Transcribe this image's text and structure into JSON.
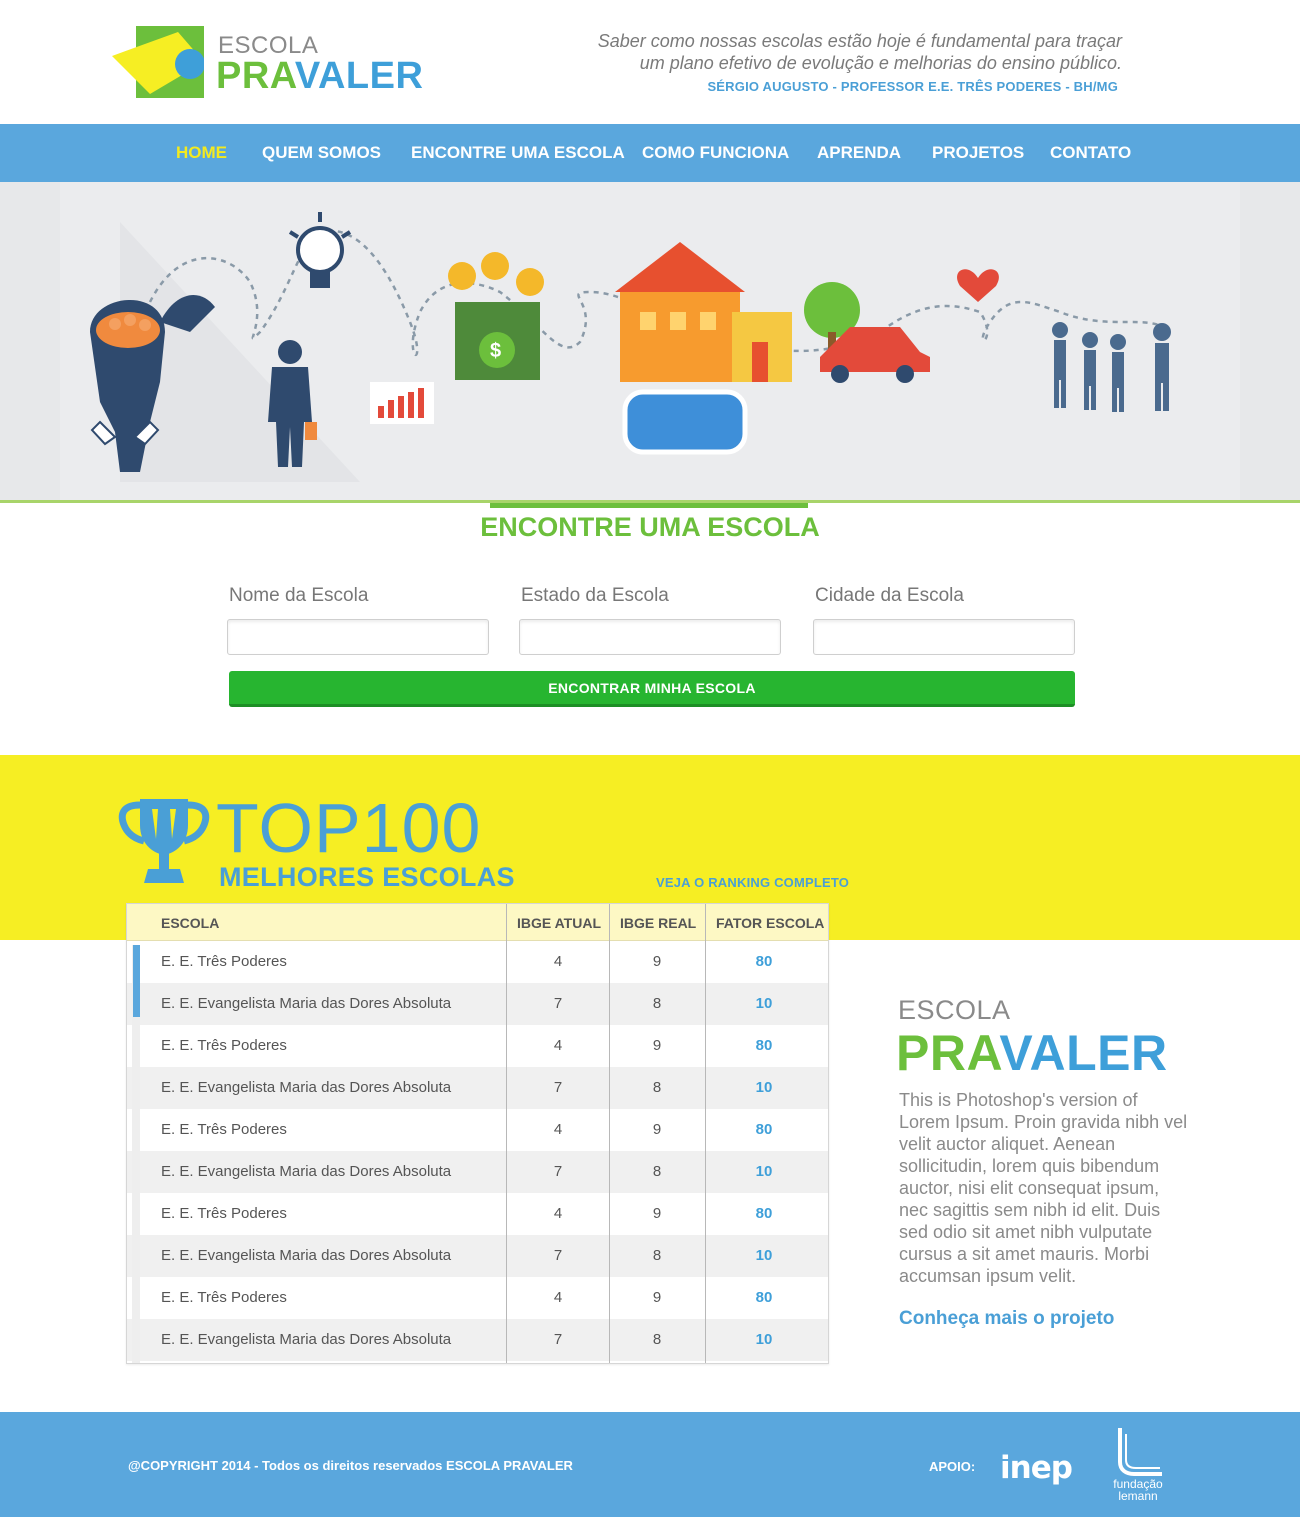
{
  "header": {
    "logo_top": "ESCOLA",
    "logo_pra": "PRA",
    "logo_valer": "VALER",
    "quote_line1": "Saber como nossas escolas estão hoje é fundamental para traçar",
    "quote_line2": "um plano efetivo de evolução e melhorias do ensino público.",
    "quote_author": "SÉRGIO AUGUSTO - PROFESSOR E.E. TRÊS PODERES - BH/MG"
  },
  "nav": {
    "items": [
      "HOME",
      "QUEM SOMOS",
      "ENCONTRE UMA ESCOLA",
      "COMO FUNCIONA",
      "APRENDA",
      "PROJETOS",
      "CONTATO"
    ],
    "active": "HOME",
    "active_color": "#f3ea1f"
  },
  "search": {
    "title": "ENCONTRE UMA ESCOLA",
    "fields": [
      {
        "label": "Nome da Escola",
        "value": ""
      },
      {
        "label": "Estado da Escola",
        "value": ""
      },
      {
        "label": "Cidade da Escola",
        "value": ""
      }
    ],
    "button": "ENCONTRAR MINHA ESCOLA"
  },
  "ranking": {
    "top": "TOP100",
    "subtitle": "MELHORES ESCOLAS",
    "link": "VEJA O RANKING COMPLETO",
    "columns": [
      "ESCOLA",
      "IBGE ATUAL",
      "IBGE REAL",
      "FATOR ESCOLA"
    ],
    "rows": [
      [
        "E. E. Três Poderes",
        "4",
        "9",
        "80"
      ],
      [
        "E. E. Evangelista Maria das Dores Absoluta",
        "7",
        "8",
        "10"
      ],
      [
        "E. E. Três Poderes",
        "4",
        "9",
        "80"
      ],
      [
        "E. E. Evangelista Maria das Dores Absoluta",
        "7",
        "8",
        "10"
      ],
      [
        "E. E. Três Poderes",
        "4",
        "9",
        "80"
      ],
      [
        "E. E. Evangelista Maria das Dores Absoluta",
        "7",
        "8",
        "10"
      ],
      [
        "E. E. Três Poderes",
        "4",
        "9",
        "80"
      ],
      [
        "E. E. Evangelista Maria das Dores Absoluta",
        "7",
        "8",
        "10"
      ],
      [
        "E. E. Três Poderes",
        "4",
        "9",
        "80"
      ],
      [
        "E. E. Evangelista Maria das Dores Absoluta",
        "7",
        "8",
        "10"
      ]
    ]
  },
  "about": {
    "escola": "ESCOLA",
    "pra": "PRA",
    "valer": "VALER",
    "text": "This is Photoshop's version  of Lorem Ipsum. Proin gravida nibh vel velit auctor aliquet. Aenean sollicitudin, lorem quis bibendum auctor, nisi elit consequat ipsum, nec sagittis sem nibh id elit. Duis sed odio sit amet nibh vulputate cursus a sit amet mauris. Morbi accumsan ipsum velit.",
    "link": "Conheça mais o projeto"
  },
  "footer": {
    "copyright": "@COPYRIGHT 2014 - Todos os direitos reservados ESCOLA PRAVALER",
    "apoio": "APOIO:",
    "inep": "inep",
    "lemann_line1": "fundação",
    "lemann_line2": "lemann"
  },
  "colors": {
    "green": "#6cbf3c",
    "blue": "#4a9fd6",
    "nav_blue": "#5aa7dd",
    "yellow": "#f6ee23",
    "button_green": "#27b530"
  }
}
